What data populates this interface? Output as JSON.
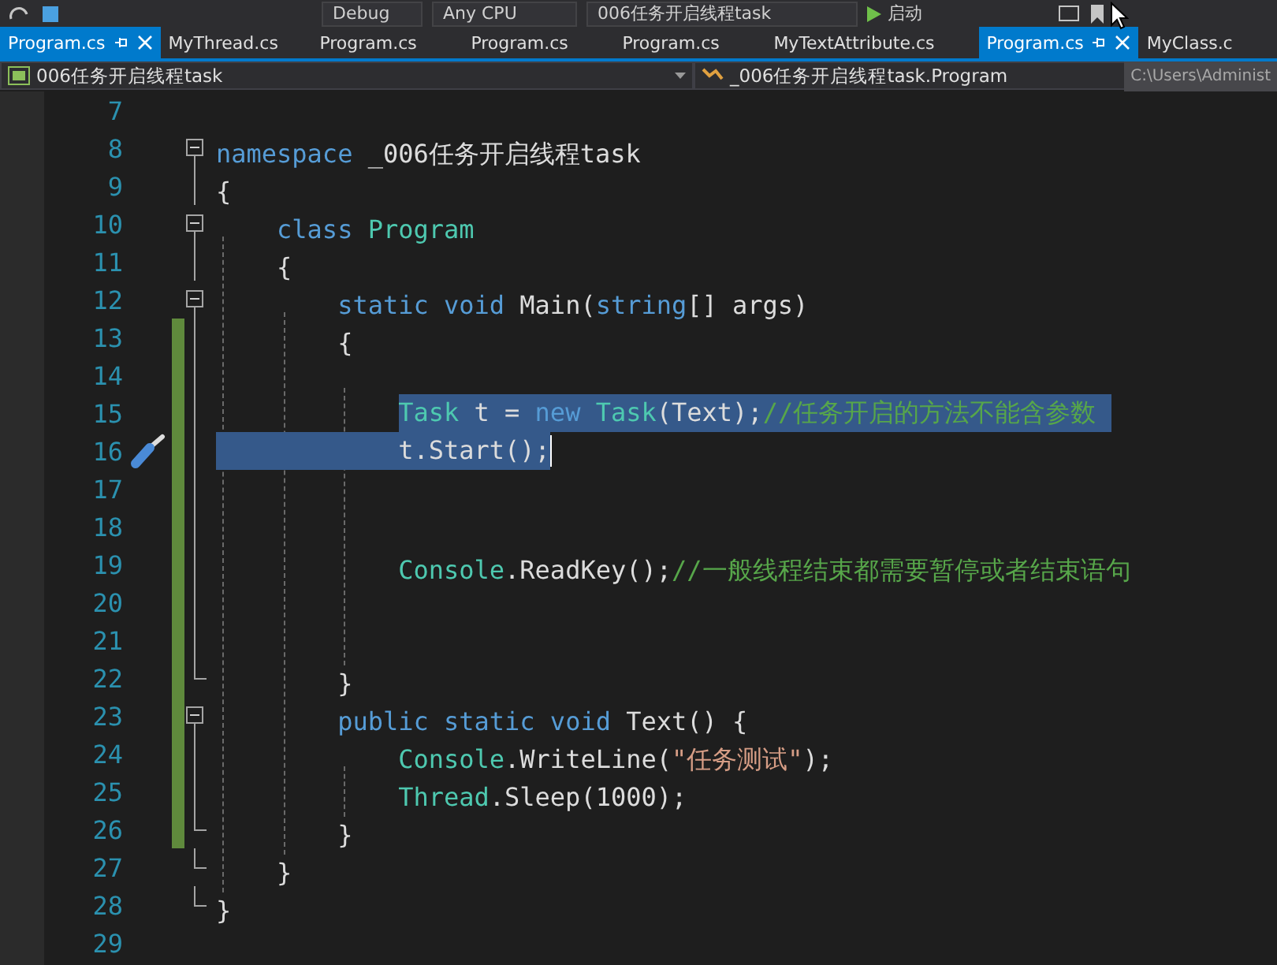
{
  "toolbar": {
    "items": [
      {
        "kind": "dropdown",
        "label": "Debug"
      },
      {
        "kind": "dropdown",
        "label": "Any CPU"
      },
      {
        "kind": "dropdown",
        "label": "006任务开启线程task"
      },
      {
        "kind": "run",
        "label": "启动"
      }
    ]
  },
  "tabs": [
    {
      "label": "Program.cs",
      "selected": true
    },
    {
      "label": "MyThread.cs",
      "selected": false
    },
    {
      "label": "Program.cs",
      "selected": false
    },
    {
      "label": "Program.cs",
      "selected": false
    },
    {
      "label": "Program.cs",
      "selected": false
    },
    {
      "label": "MyTextAttribute.cs",
      "selected": false
    },
    {
      "label": "Program.cs",
      "selected": true
    },
    {
      "label": "MyClass.c",
      "selected": false
    }
  ],
  "nav_bar": {
    "project": "006任务开启线程task",
    "member": "_006任务开启线程task.Program"
  },
  "tooltip": "C:\\Users\\Administ",
  "editor": {
    "lines": [
      {
        "number": "7"
      },
      {
        "number": "8",
        "kind": "fold_start",
        "tokens": [
          {
            "kind": "kw",
            "s": "namespace"
          },
          {
            "kind": "plain",
            "s": " _006任务开启线程task"
          }
        ]
      },
      {
        "number": "9",
        "kind": "fold_body",
        "tokens": [
          {
            "kind": "plain",
            "s": "{"
          }
        ],
        "children": [
          {
            "number": "10",
            "kind": "fold_start",
            "tokens": [
              {
                "kind": "kw",
                "s": "class"
              },
              {
                "kind": "type",
                "s": " Program"
              }
            ]
          },
          {
            "number": "11",
            "kind": "fold_body",
            "tokens": [
              {
                "kind": "plain",
                "s": "{"
              }
            ],
            "children": [
              {
                "number": "12",
                "kind": "fold_start",
                "tokens": [
                  {
                    "kind": "kw",
                    "s": "static"
                  },
                  {
                    "kind": "kw",
                    "s": " void"
                  },
                  {
                    "kind": "plain",
                    "s": " Main("
                  },
                  {
                    "kind": "kw",
                    "s": "string"
                  },
                  {
                    "kind": "plain",
                    "s": "[] args)"
                  }
                ]
              },
              {
                "number": "13",
                "kind": "fold_body",
                "changed": true,
                "tokens": [
                  {
                    "kind": "plain",
                    "s": "{"
                  }
                ],
                "children": [
                  {
                    "number": "14",
                    "kind": "fold_body",
                    "changed": true
                  },
                  {
                    "number": "15",
                    "kind": "fold_body",
                    "changed": true,
                    "selected": true,
                    "tokens": [
                      {
                        "kind": "type",
                        "s": "Task"
                      },
                      {
                        "kind": "plain",
                        "s": " t = "
                      },
                      {
                        "kind": "kw",
                        "s": "new"
                      },
                      {
                        "kind": "type",
                        "s": " Task"
                      },
                      {
                        "kind": "plain",
                        "s": "(Text);"
                      },
                      {
                        "kind": "comment",
                        "s": "//任务开启的方法不能含参数 "
                      }
                    ]
                  },
                  {
                    "number": "16",
                    "kind": "fold_body",
                    "changed": true,
                    "selected": true,
                    "caret": true,
                    "quick_action": true,
                    "tokens": [
                      {
                        "kind": "plain",
                        "s": "t.Start();"
                      }
                    ]
                  },
                  {
                    "number": "17",
                    "kind": "fold_body",
                    "changed": true
                  },
                  {
                    "number": "18",
                    "kind": "fold_body",
                    "changed": true
                  },
                  {
                    "number": "19",
                    "kind": "fold_body",
                    "changed": true,
                    "tokens": [
                      {
                        "kind": "type",
                        "s": "Console"
                      },
                      {
                        "kind": "plain",
                        "s": ".ReadKey();"
                      },
                      {
                        "kind": "comment",
                        "s": "//一般线程结束都需要暂停或者结束语句"
                      }
                    ]
                  },
                  {
                    "number": "20",
                    "kind": "fold_body",
                    "changed": true
                  },
                  {
                    "number": "21",
                    "kind": "fold_body",
                    "changed": true
                  }
                ]
              },
              {
                "number": "22",
                "kind": "fold_end",
                "changed": true,
                "tokens": [
                  {
                    "kind": "plain",
                    "s": "}"
                  }
                ]
              },
              {
                "number": "23",
                "kind": "fold_start",
                "changed": true,
                "tokens": [
                  {
                    "kind": "kw",
                    "s": "public"
                  },
                  {
                    "kind": "kw",
                    "s": " static"
                  },
                  {
                    "kind": "kw",
                    "s": " void"
                  },
                  {
                    "kind": "plain",
                    "s": " Text() {"
                  }
                ],
                "children": [
                  {
                    "number": "24",
                    "kind": "fold_body",
                    "changed": true,
                    "tokens": [
                      {
                        "kind": "type",
                        "s": "Console"
                      },
                      {
                        "kind": "plain",
                        "s": ".WriteLine("
                      },
                      {
                        "kind": "str",
                        "s": "\"任务测试\""
                      },
                      {
                        "kind": "plain",
                        "s": ");"
                      }
                    ]
                  },
                  {
                    "number": "25",
                    "kind": "fold_body",
                    "changed": true,
                    "tokens": [
                      {
                        "kind": "type",
                        "s": "Thread"
                      },
                      {
                        "kind": "plain",
                        "s": ".Sleep(1000);"
                      }
                    ]
                  }
                ]
              },
              {
                "number": "26",
                "kind": "fold_end",
                "changed": true,
                "tokens": [
                  {
                    "kind": "plain",
                    "s": "}"
                  }
                ]
              }
            ]
          },
          {
            "number": "27",
            "kind": "fold_end",
            "tokens": [
              {
                "kind": "plain",
                "s": "}"
              }
            ]
          }
        ]
      },
      {
        "number": "28",
        "kind": "fold_end",
        "tokens": [
          {
            "kind": "plain",
            "s": "}"
          }
        ]
      },
      {
        "number": "29"
      }
    ]
  }
}
